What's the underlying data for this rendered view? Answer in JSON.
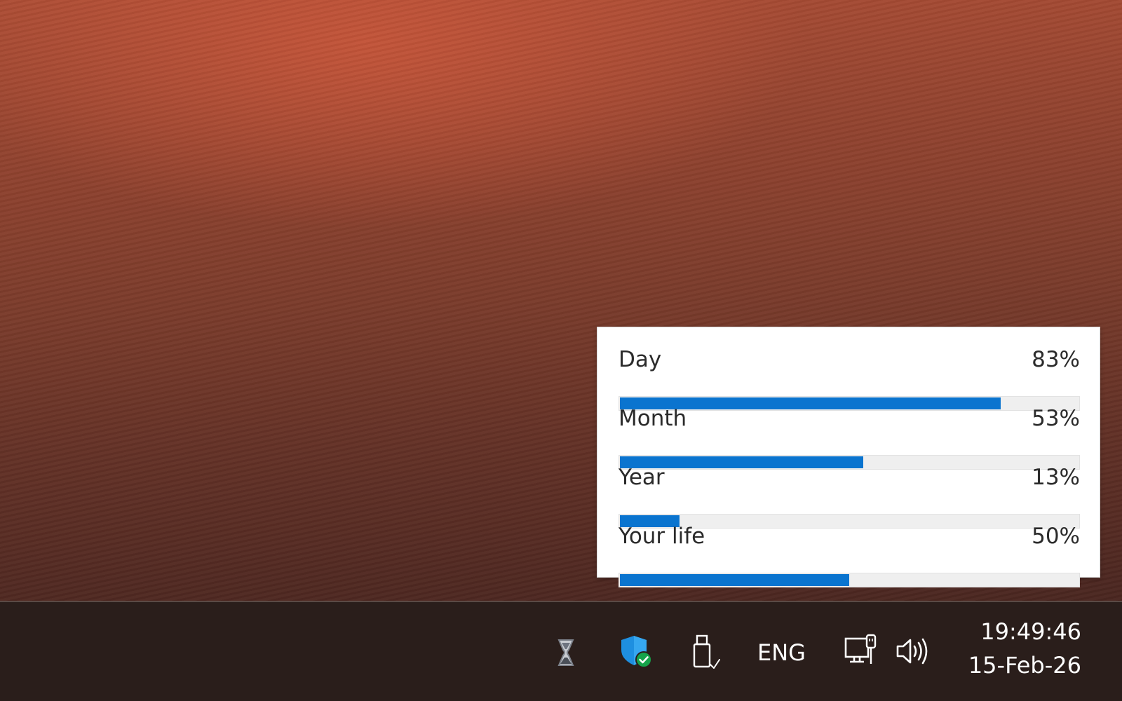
{
  "progress_panel": {
    "rows": [
      {
        "label": "Day",
        "value_text": "83%",
        "fraction": 0.83
      },
      {
        "label": "Month",
        "value_text": "53%",
        "fraction": 0.53
      },
      {
        "label": "Year",
        "value_text": "13%",
        "fraction": 0.13
      },
      {
        "label": "Your life",
        "value_text": "50%",
        "fraction": 0.5
      }
    ],
    "bar_color": "#0a74cf",
    "track_color": "#efefef"
  },
  "taskbar": {
    "icons": [
      {
        "name": "hourglass-icon"
      },
      {
        "name": "windows-security-shield-icon"
      },
      {
        "name": "usb-drive-icon"
      },
      {
        "name": "network-icon"
      },
      {
        "name": "volume-icon"
      }
    ],
    "language": "ENG",
    "clock": {
      "time": "19:49:46",
      "date": "15-Feb-26"
    }
  },
  "colors": {
    "taskbar_bg": "#2a1e1b",
    "shield_blue": "#1e8fe0",
    "check_green": "#16a34a"
  }
}
